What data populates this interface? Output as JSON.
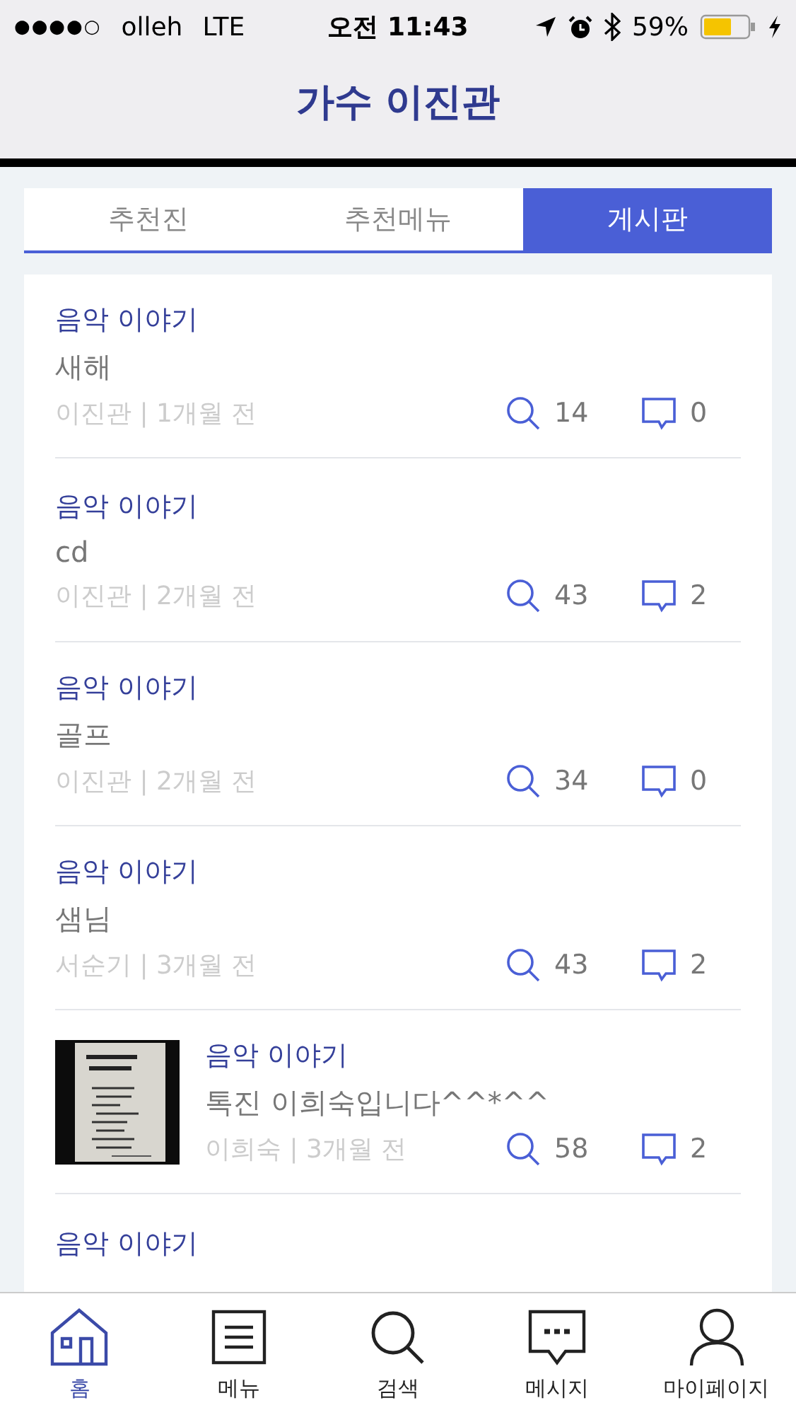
{
  "status_bar": {
    "signal": "●●●●○",
    "carrier": "olleh",
    "network": "LTE",
    "time": "오전 11:43",
    "battery": "59%"
  },
  "header": {
    "title": "가수 이진관"
  },
  "tabs": [
    {
      "label": "추천진",
      "selected": false
    },
    {
      "label": "추천메뉴",
      "selected": false
    },
    {
      "label": "게시판",
      "selected": true
    }
  ],
  "posts": [
    {
      "category": "음악 이야기",
      "title": "새해",
      "byline": "이진관 | 1개월 전",
      "views": "14",
      "comments": "0"
    },
    {
      "category": "음악 이야기",
      "title": "cd",
      "byline": "이진관 | 2개월 전",
      "views": "43",
      "comments": "2"
    },
    {
      "category": "음악 이야기",
      "title": "골프",
      "byline": "이진관 | 2개월 전",
      "views": "34",
      "comments": "0"
    },
    {
      "category": "음악 이야기",
      "title": "샘님",
      "byline": "서순기 | 3개월 전",
      "views": "43",
      "comments": "2"
    },
    {
      "category": "음악 이야기",
      "title": "톡진 이희숙입니다^^*^^",
      "byline": "이희숙 | 3개월 전",
      "views": "58",
      "comments": "2"
    },
    {
      "category": "음악 이야기"
    }
  ],
  "bottom_nav": [
    {
      "label": "홈",
      "kind": "home",
      "selected": true
    },
    {
      "label": "메뉴",
      "kind": "menu",
      "selected": false
    },
    {
      "label": "검색",
      "kind": "search",
      "selected": false
    },
    {
      "label": "메시지",
      "kind": "message",
      "selected": false
    },
    {
      "label": "마이페이지",
      "kind": "profile",
      "selected": false
    }
  ]
}
